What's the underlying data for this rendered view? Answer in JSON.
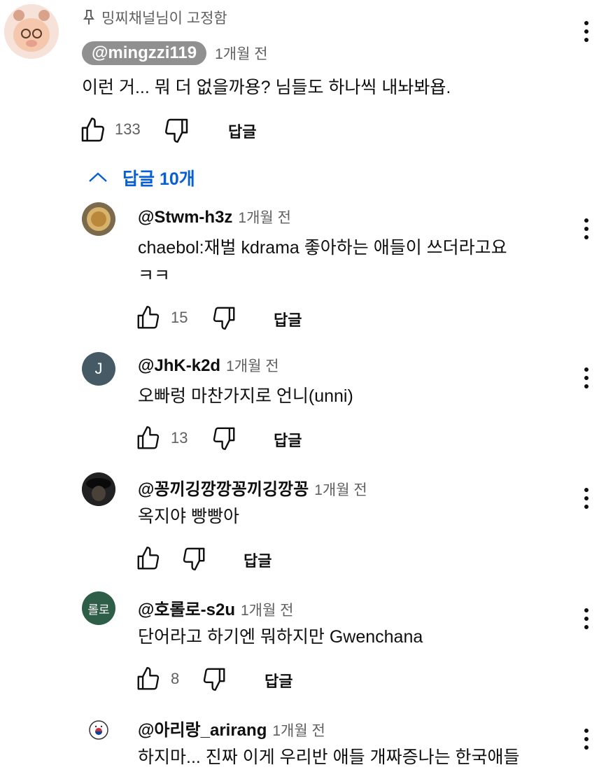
{
  "pinned": {
    "label": "밍찌채널님이 고정함",
    "author": "@mingzzi119",
    "time": "1개월 전",
    "text": "이런 거... 뭐 더 없을까용? 님들도 하나씩 내놔봐욥.",
    "likes": "133",
    "reply_label": "답글"
  },
  "replies_toggle": "답글 10개",
  "replies": [
    {
      "author": "@Stwm-h3z",
      "time": "1개월 전",
      "line1": "chaebol:재벌  kdrama 좋아하는 애들이 쓰더라고요",
      "line2": "ㅋㅋ",
      "likes": "15",
      "reply_label": "답글"
    },
    {
      "author": "@JhK-k2d",
      "time": "1개월 전",
      "line1": "오빠렁 마찬가지로 언니(unni)",
      "likes": "13",
      "reply_label": "답글",
      "avatar_letter": "J"
    },
    {
      "author": "@꽁끼깅깡깡꽁끼깅깡꽁",
      "time": "1개월 전",
      "line1": "옥지야 빵빵아",
      "reply_label": "답글"
    },
    {
      "author": "@호롤로-s2u",
      "time": "1개월 전",
      "line1": "단어라고 하기엔 뭐하지만 Gwenchana",
      "likes": "8",
      "reply_label": "답글",
      "avatar_letter": "롤로"
    },
    {
      "author": "@아리랑_arirang",
      "time": "1개월 전",
      "line1": "하지마... 진짜 이게 우리반 애들 개짜증나는 한국애들"
    }
  ],
  "colors": {
    "link_blue": "#065fd4",
    "muted": "#606060",
    "badge": "#909090"
  }
}
